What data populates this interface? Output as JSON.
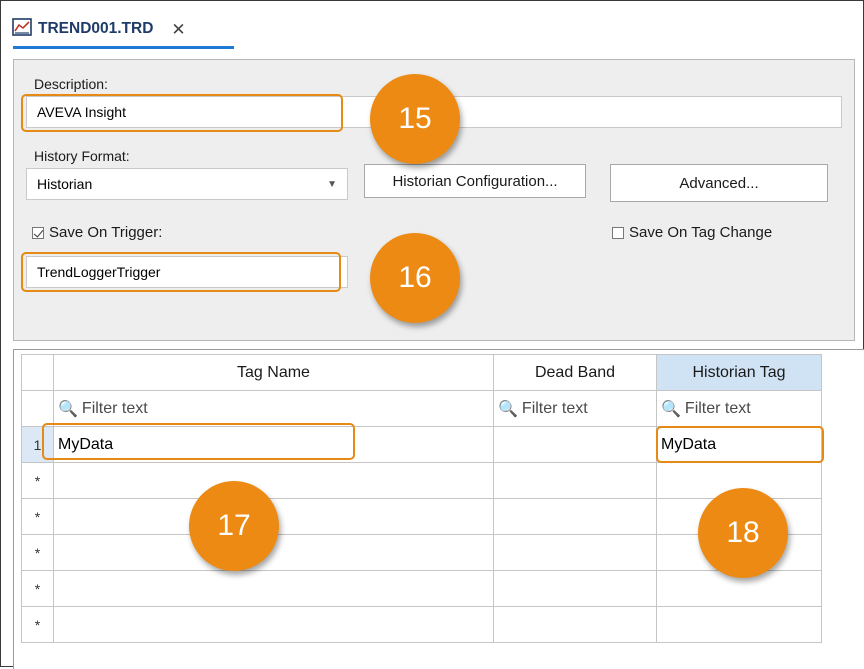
{
  "tab": {
    "title": "TREND001.TRD",
    "close_glyph": "✕",
    "icon": "trend-file-icon",
    "accent": "#1e7ad6"
  },
  "form": {
    "description_label": "Description:",
    "description_value": "AVEVA Insight",
    "history_format_label": "History Format:",
    "history_format_value": "Historian",
    "historian_config_button": "Historian Configuration...",
    "advanced_button": "Advanced...",
    "save_on_trigger_label": "Save On Trigger:",
    "save_on_trigger_checked": true,
    "trigger_value": "TrendLoggerTrigger",
    "save_on_tag_change_label": "Save On Tag Change",
    "save_on_tag_change_checked": false
  },
  "grid": {
    "columns": [
      "Tag Name",
      "Dead Band",
      "Historian Tag"
    ],
    "filter_placeholder": "Filter text",
    "rows": [
      {
        "header": "1",
        "tag_name": "MyData",
        "dead_band": "",
        "historian_tag": "MyData"
      },
      {
        "header": "*",
        "tag_name": "",
        "dead_band": "",
        "historian_tag": ""
      },
      {
        "header": "*",
        "tag_name": "",
        "dead_band": "",
        "historian_tag": ""
      },
      {
        "header": "*",
        "tag_name": "",
        "dead_band": "",
        "historian_tag": ""
      },
      {
        "header": "*",
        "tag_name": "",
        "dead_band": "",
        "historian_tag": ""
      },
      {
        "header": "*",
        "tag_name": "",
        "dead_band": "",
        "historian_tag": ""
      }
    ]
  },
  "callouts": [
    "15",
    "16",
    "17",
    "18"
  ],
  "colors": {
    "callout": "#ec8a13",
    "selected_header": "#cfe3f4"
  }
}
